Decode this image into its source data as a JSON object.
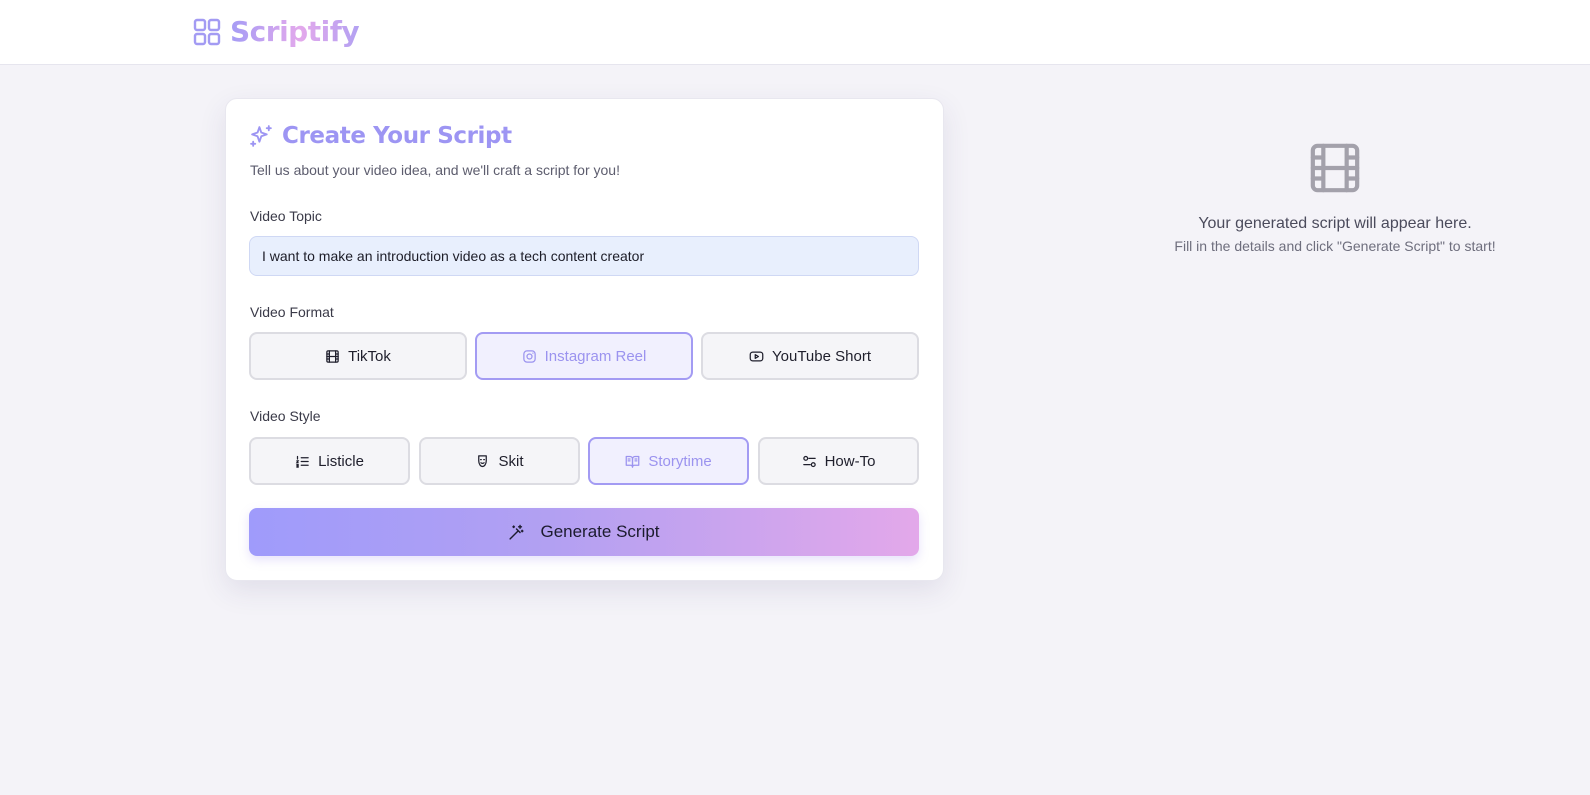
{
  "header": {
    "brand": "Scriptify",
    "brand_icon": "grid-icon"
  },
  "form": {
    "title": "Create Your Script",
    "title_icon": "sparkles-icon",
    "subtitle": "Tell us about your video idea, and we'll craft a script for you!",
    "topic_label": "Video Topic",
    "topic_value": "I want to make an introduction video as a tech content creator",
    "format_label": "Video Format",
    "formats": [
      {
        "label": "TikTok",
        "icon": "film-icon",
        "selected": false
      },
      {
        "label": "Instagram Reel",
        "icon": "instagram-icon",
        "selected": true
      },
      {
        "label": "YouTube Short",
        "icon": "youtube-icon",
        "selected": false
      }
    ],
    "style_label": "Video Style",
    "styles": [
      {
        "label": "Listicle",
        "icon": "list-ordered-icon",
        "selected": false
      },
      {
        "label": "Skit",
        "icon": "drama-masks-icon",
        "selected": false
      },
      {
        "label": "Storytime",
        "icon": "book-open-icon",
        "selected": true
      },
      {
        "label": "How-To",
        "icon": "sliders-icon",
        "selected": false
      }
    ],
    "generate_label": "Generate Script",
    "generate_icon": "magic-wand-icon"
  },
  "output": {
    "icon": "film-icon",
    "placeholder_title": "Your generated script will appear here.",
    "placeholder_hint": "Fill in the details and click \"Generate Script\" to start!"
  },
  "colors": {
    "accent": "#9d95f3",
    "accent_pink": "#e3a8ea",
    "selected_border": "#a39bf3",
    "input_bg": "#e8effd",
    "page_bg": "#f4f3f8"
  }
}
